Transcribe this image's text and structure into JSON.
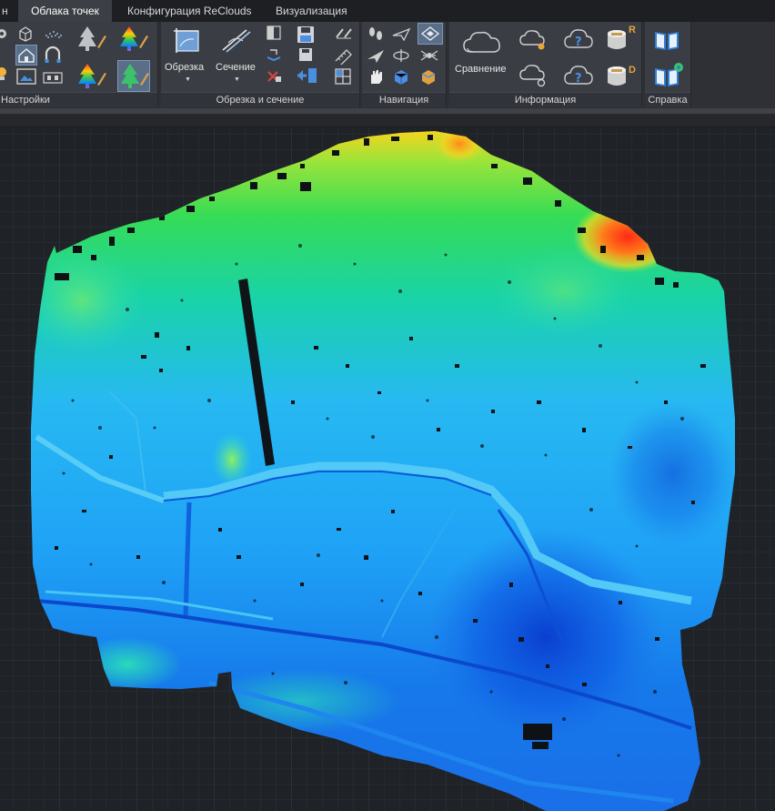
{
  "tabs": [
    {
      "label": "н"
    },
    {
      "label": "Облака точек",
      "active": true
    },
    {
      "label": "Конфигурация ReClouds"
    },
    {
      "label": "Визуализация"
    }
  ],
  "ribbon": {
    "groups": {
      "settings": {
        "label": "Настройки"
      },
      "clip": {
        "label": "Обрезка и сечение",
        "clip_button": "Обрезка",
        "section_button": "Сечение"
      },
      "navigation": {
        "label": "Навигация"
      },
      "info": {
        "label": "Информация",
        "compare_button": "Сравнение",
        "r_badge": "R",
        "d_badge": "D"
      },
      "help": {
        "label": "Справка"
      }
    }
  },
  "colors": {
    "tab_active": "#3c3f45",
    "ribbon_bg": "#3a3d43",
    "selected_button": "#5a6e88",
    "viewport_bg": "#1f2227",
    "badge_orange": "#e8a33a",
    "cloud_low": "#0a4fd8",
    "cloud_mid": "#22c8f0",
    "cloud_high": "#7ce640",
    "cloud_peak": "#ff3a1a"
  },
  "icons": [
    "cube-icon",
    "hatch-icon",
    "tree-pen-icon",
    "tree-rainbow-pen-icon",
    "house-cloud-icon",
    "magnet-house-icon",
    "tree-color-icon",
    "tree-green-icon",
    "crop-icon",
    "section-knife-icon",
    "save-icon",
    "binoculars-icon",
    "footprints-icon",
    "plane-icon",
    "hand-icon",
    "cloud-compare-icon",
    "cloud-question-icon",
    "database-icon",
    "book-icon"
  ]
}
